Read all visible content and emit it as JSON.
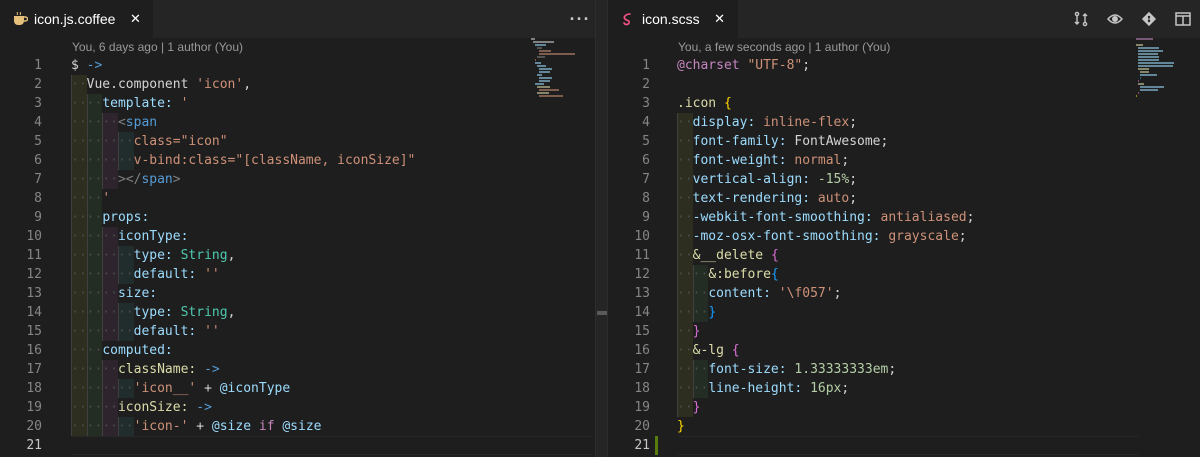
{
  "left": {
    "tab_label": "icon.js.coffee",
    "tab_icon": "coffee-icon",
    "close_glyph": "✕",
    "more_glyph": "···",
    "blame": "You, 6 days ago | 1 author (You)",
    "lines": [
      {
        "n": "1",
        "indent": 0,
        "tokens": [
          [
            "$",
            "t-white"
          ],
          [
            " ",
            "t-white"
          ],
          [
            "->",
            "t-blue"
          ]
        ]
      },
      {
        "n": "2",
        "indent": 1,
        "tokens": [
          [
            "Vue.component",
            "t-white"
          ],
          [
            " ",
            "t-white"
          ],
          [
            "'icon'",
            "t-orange"
          ],
          [
            ",",
            "t-white"
          ]
        ]
      },
      {
        "n": "3",
        "indent": 2,
        "tokens": [
          [
            "template:",
            "t-light"
          ],
          [
            " ",
            "t-white"
          ],
          [
            "'",
            "t-orange"
          ]
        ]
      },
      {
        "n": "4",
        "indent": 3,
        "tokens": [
          [
            "<",
            "t-gray"
          ],
          [
            "span",
            "t-blue"
          ]
        ]
      },
      {
        "n": "5",
        "indent": 4,
        "tokens": [
          [
            "class=\"icon\"",
            "t-orange"
          ]
        ]
      },
      {
        "n": "6",
        "indent": 4,
        "tokens": [
          [
            "v-bind:class=\"[className, iconSize]\"",
            "t-orange"
          ]
        ]
      },
      {
        "n": "7",
        "indent": 3,
        "tokens": [
          [
            "></",
            "t-gray"
          ],
          [
            "span",
            "t-blue"
          ],
          [
            ">",
            "t-gray"
          ]
        ]
      },
      {
        "n": "8",
        "indent": 2,
        "tokens": [
          [
            "'",
            "t-orange"
          ]
        ]
      },
      {
        "n": "9",
        "indent": 2,
        "tokens": [
          [
            "props:",
            "t-light"
          ]
        ]
      },
      {
        "n": "10",
        "indent": 3,
        "tokens": [
          [
            "iconType:",
            "t-light"
          ]
        ]
      },
      {
        "n": "11",
        "indent": 4,
        "tokens": [
          [
            "type:",
            "t-light"
          ],
          [
            " ",
            "t-white"
          ],
          [
            "String",
            "t-green"
          ],
          [
            ",",
            "t-white"
          ]
        ]
      },
      {
        "n": "12",
        "indent": 4,
        "tokens": [
          [
            "default:",
            "t-light"
          ],
          [
            " ",
            "t-white"
          ],
          [
            "''",
            "t-orange"
          ]
        ]
      },
      {
        "n": "13",
        "indent": 3,
        "tokens": [
          [
            "size:",
            "t-light"
          ]
        ]
      },
      {
        "n": "14",
        "indent": 4,
        "tokens": [
          [
            "type:",
            "t-light"
          ],
          [
            " ",
            "t-white"
          ],
          [
            "String",
            "t-green"
          ],
          [
            ",",
            "t-white"
          ]
        ]
      },
      {
        "n": "15",
        "indent": 4,
        "tokens": [
          [
            "default:",
            "t-light"
          ],
          [
            " ",
            "t-white"
          ],
          [
            "''",
            "t-orange"
          ]
        ]
      },
      {
        "n": "16",
        "indent": 2,
        "tokens": [
          [
            "computed:",
            "t-light"
          ]
        ]
      },
      {
        "n": "17",
        "indent": 3,
        "tokens": [
          [
            "className:",
            "t-yellow"
          ],
          [
            " ",
            "t-white"
          ],
          [
            "->",
            "t-blue"
          ]
        ]
      },
      {
        "n": "18",
        "indent": 4,
        "tokens": [
          [
            "'icon__'",
            "t-orange"
          ],
          [
            " + ",
            "t-white"
          ],
          [
            "@iconType",
            "t-light"
          ]
        ]
      },
      {
        "n": "19",
        "indent": 3,
        "tokens": [
          [
            "iconSize:",
            "t-yellow"
          ],
          [
            " ",
            "t-white"
          ],
          [
            "->",
            "t-blue"
          ]
        ]
      },
      {
        "n": "20",
        "indent": 4,
        "tokens": [
          [
            "'icon-'",
            "t-orange"
          ],
          [
            " + ",
            "t-white"
          ],
          [
            "@size",
            "t-light"
          ],
          [
            " ",
            "t-white"
          ],
          [
            "if",
            "t-pink"
          ],
          [
            " ",
            "t-white"
          ],
          [
            "@size",
            "t-light"
          ]
        ]
      },
      {
        "n": "21",
        "indent": 0,
        "tokens": []
      }
    ]
  },
  "right": {
    "tab_label": "icon.scss",
    "tab_icon": "sass-icon",
    "close_glyph": "✕",
    "blame": "You, a few seconds ago | 1 author (You)",
    "actions": [
      "compare-changes-icon",
      "preview-icon",
      "git-icon",
      "split-editor-icon"
    ],
    "lines": [
      {
        "n": "1",
        "indent": 0,
        "tokens": [
          [
            "@charset",
            "t-pink"
          ],
          [
            " ",
            "t-white"
          ],
          [
            "\"UTF-8\"",
            "t-orange"
          ],
          [
            ";",
            "t-white"
          ]
        ]
      },
      {
        "n": "2",
        "indent": 0,
        "tokens": []
      },
      {
        "n": "3",
        "indent": 0,
        "tokens": [
          [
            ".icon",
            "t-yellow"
          ],
          [
            " ",
            "t-white"
          ],
          [
            "{",
            "t-brace"
          ]
        ]
      },
      {
        "n": "4",
        "indent": 1,
        "tokens": [
          [
            "display:",
            "t-light"
          ],
          [
            " ",
            "t-white"
          ],
          [
            "inline-flex",
            "t-orange"
          ],
          [
            ";",
            "t-white"
          ]
        ]
      },
      {
        "n": "5",
        "indent": 1,
        "tokens": [
          [
            "font-family:",
            "t-light"
          ],
          [
            " FontAwesome;",
            "t-white"
          ]
        ]
      },
      {
        "n": "6",
        "indent": 1,
        "tokens": [
          [
            "font-weight:",
            "t-light"
          ],
          [
            " ",
            "t-white"
          ],
          [
            "normal",
            "t-orange"
          ],
          [
            ";",
            "t-white"
          ]
        ]
      },
      {
        "n": "7",
        "indent": 1,
        "tokens": [
          [
            "vertical-align:",
            "t-light"
          ],
          [
            " ",
            "t-white"
          ],
          [
            "-15%",
            "t-number"
          ],
          [
            ";",
            "t-white"
          ]
        ]
      },
      {
        "n": "8",
        "indent": 1,
        "tokens": [
          [
            "text-rendering:",
            "t-light"
          ],
          [
            " ",
            "t-white"
          ],
          [
            "auto",
            "t-orange"
          ],
          [
            ";",
            "t-white"
          ]
        ]
      },
      {
        "n": "9",
        "indent": 1,
        "tokens": [
          [
            "-webkit-font-smoothing:",
            "t-light"
          ],
          [
            " ",
            "t-white"
          ],
          [
            "antialiased",
            "t-orange"
          ],
          [
            ";",
            "t-white"
          ]
        ]
      },
      {
        "n": "10",
        "indent": 1,
        "tokens": [
          [
            "-moz-osx-font-smoothing:",
            "t-light"
          ],
          [
            " ",
            "t-white"
          ],
          [
            "grayscale",
            "t-orange"
          ],
          [
            ";",
            "t-white"
          ]
        ]
      },
      {
        "n": "11",
        "indent": 1,
        "tokens": [
          [
            "&__delete",
            "t-yellow"
          ],
          [
            " ",
            "t-white"
          ],
          [
            "{",
            "t-brace2"
          ]
        ]
      },
      {
        "n": "12",
        "indent": 2,
        "tokens": [
          [
            "&:before",
            "t-yellow"
          ],
          [
            "{",
            "t-brace3"
          ]
        ]
      },
      {
        "n": "13",
        "indent": 2,
        "tokens": [
          [
            "content:",
            "t-light"
          ],
          [
            " ",
            "t-white"
          ],
          [
            "'\\f057'",
            "t-orange"
          ],
          [
            ";",
            "t-white"
          ]
        ]
      },
      {
        "n": "14",
        "indent": 2,
        "tokens": [
          [
            "}",
            "t-brace3"
          ]
        ]
      },
      {
        "n": "15",
        "indent": 1,
        "tokens": [
          [
            "}",
            "t-brace2"
          ]
        ]
      },
      {
        "n": "16",
        "indent": 1,
        "tokens": [
          [
            "&-lg",
            "t-yellow"
          ],
          [
            " ",
            "t-white"
          ],
          [
            "{",
            "t-brace2"
          ]
        ]
      },
      {
        "n": "17",
        "indent": 2,
        "tokens": [
          [
            "font-size:",
            "t-light"
          ],
          [
            " ",
            "t-white"
          ],
          [
            "1.33333333em",
            "t-number"
          ],
          [
            ";",
            "t-white"
          ]
        ]
      },
      {
        "n": "18",
        "indent": 2,
        "tokens": [
          [
            "line-height:",
            "t-light"
          ],
          [
            " ",
            "t-white"
          ],
          [
            "16px",
            "t-number"
          ],
          [
            ";",
            "t-white"
          ]
        ]
      },
      {
        "n": "19",
        "indent": 1,
        "tokens": [
          [
            "}",
            "t-brace2"
          ]
        ]
      },
      {
        "n": "20",
        "indent": 0,
        "tokens": [
          [
            "}",
            "t-brace"
          ]
        ]
      },
      {
        "n": "21",
        "indent": 0,
        "tokens": []
      }
    ]
  },
  "colors": {
    "background": "#1e1e1e",
    "tabbar": "#252526",
    "line_number": "#858585",
    "modified_gutter": "#587c0c"
  }
}
